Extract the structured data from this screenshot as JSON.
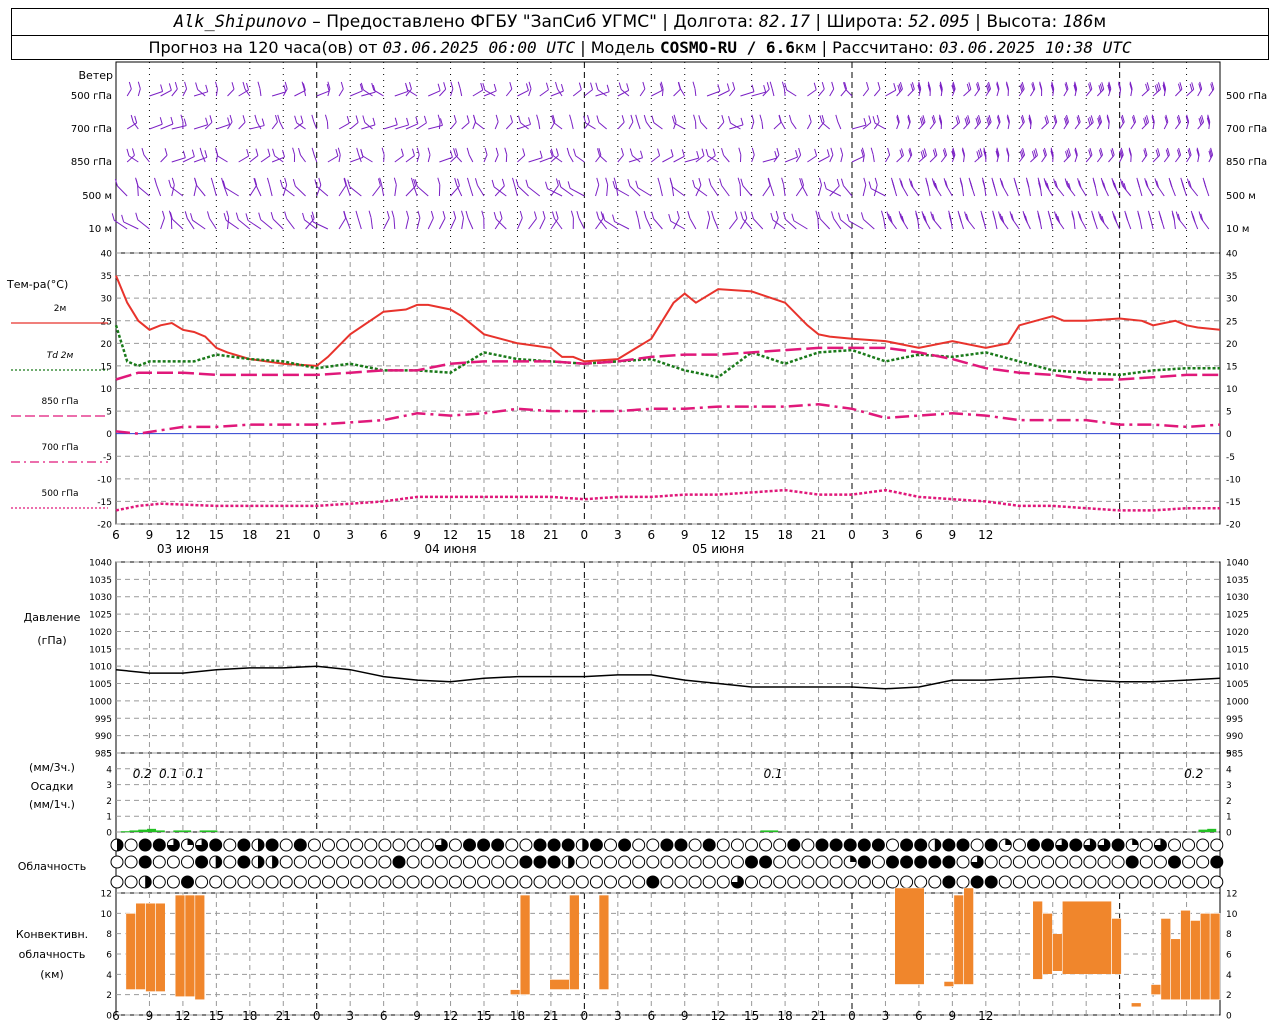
{
  "header": {
    "station": "Alk_Shipunovo",
    "provider": " – Предоставлено ФГБУ \"ЗапСиб УГМС\" | Долгота: ",
    "lon": "82.17",
    "lat_label": " | Широта: ",
    "lat": "52.095",
    "alt_label": " | Высота: ",
    "alt": "186",
    "alt_unit": "м",
    "fc_label": "Прогноз на 120 часа(ов) от ",
    "fc_time": "03.06.2025 06:00 UTC",
    "model_label": "  | Модель ",
    "model": "COSMO-RU / 6.6",
    "model_unit": "км",
    "calc_label": " | Рассчитано: ",
    "calc_time": "03.06.2025 10:38 UTC"
  },
  "panels": {
    "wind": {
      "title": "Ветер",
      "levels": [
        "500 гПа",
        "700 гПа",
        "850 гПа",
        "500 м",
        "10  м"
      ]
    },
    "temperature": {
      "title": "Тем-ра(°С)",
      "legend": [
        {
          "label": "2м",
          "color": "#e8332c",
          "style": "solid"
        },
        {
          "label": "Td  2м",
          "color": "#1a7a1a",
          "style": "dot"
        },
        {
          "label": "850 гПа",
          "color": "#e0187a",
          "style": "longdash"
        },
        {
          "label": "700 гПа",
          "color": "#e0187a",
          "style": "dashdot"
        },
        {
          "label": "500 гПа",
          "color": "#e0187a",
          "style": "dot"
        }
      ],
      "yticks": [
        40,
        35,
        30,
        25,
        20,
        15,
        10,
        5,
        0,
        -5,
        -10,
        -15,
        -20
      ]
    },
    "pressure": {
      "title": "Давление",
      "unit": "(гПа)",
      "yticks": [
        1040,
        1035,
        1030,
        1025,
        1020,
        1015,
        1010,
        1005,
        1000,
        995,
        990,
        985
      ]
    },
    "precip": {
      "label1": "(мм/3ч.)",
      "label2": "Осадки",
      "label3": "(мм/1ч.)",
      "yticks": [
        5,
        4,
        3,
        2,
        1,
        0
      ],
      "annotations": [
        {
          "x": 9,
          "text": "0.2"
        },
        {
          "x": 12,
          "text": "0.1"
        },
        {
          "x": 15,
          "text": "0.1"
        },
        {
          "x": 81,
          "text": "0.1"
        },
        {
          "x": 129,
          "text": "0.2"
        }
      ]
    },
    "cloud": {
      "title": "Облачность"
    },
    "convective": {
      "title1": "Конвективн.",
      "title2": "облачность",
      "title3": "(км)",
      "yticks": [
        12,
        10,
        8,
        6,
        4,
        2,
        0
      ]
    }
  },
  "xaxis": {
    "hour_labels": [
      "6",
      "9",
      "12",
      "15",
      "18",
      "21",
      "0",
      "3",
      "6",
      "9",
      "12",
      "15",
      "18",
      "21",
      "0",
      "3",
      "6",
      "9",
      "12",
      "15",
      "18",
      "21",
      "0",
      "3",
      "6",
      "9",
      "12"
    ],
    "day_labels": [
      {
        "x": 12,
        "text": "03 июня"
      },
      {
        "x": 36,
        "text": "04 июня"
      },
      {
        "x": 60,
        "text": "05 июня"
      }
    ]
  },
  "chart_data": [
    {
      "type": "line",
      "title": "Тем-ра(°С)",
      "x_unit": "hours since 03.06.2025 00 UTC",
      "ylim": [
        -20,
        40
      ],
      "series": [
        {
          "name": "2м",
          "x": [
            6,
            7,
            8,
            9,
            10,
            11,
            12,
            13,
            14,
            15,
            16,
            18,
            21,
            24,
            25,
            27,
            30,
            32,
            33,
            34,
            36,
            37,
            39,
            42,
            45,
            46,
            47,
            48,
            51,
            54,
            55,
            56,
            57,
            58,
            60,
            63,
            66,
            68,
            69,
            70,
            72,
            75,
            78,
            81,
            84,
            86,
            87,
            90,
            91,
            93,
            96,
            98,
            99,
            101,
            102,
            103,
            105
          ],
          "y": [
            35,
            29,
            25,
            23,
            24,
            24.5,
            23,
            22.5,
            21.5,
            19,
            18,
            16.5,
            15.5,
            15,
            17,
            22,
            27,
            27.5,
            28.5,
            28.5,
            27.5,
            26,
            22,
            20,
            19,
            17,
            17,
            16,
            16.5,
            21,
            25,
            29,
            31,
            29,
            32,
            31.5,
            29,
            24,
            22,
            21.5,
            21,
            20.5,
            19,
            20.5,
            19,
            20,
            24,
            26,
            25,
            25,
            25.5,
            25,
            24,
            25,
            24,
            23.5,
            23
          ]
        },
        {
          "name": "Td  2м",
          "x": [
            6,
            7,
            8,
            9,
            11,
            13,
            15,
            18,
            21,
            24,
            27,
            30,
            33,
            36,
            39,
            42,
            45,
            48,
            51,
            54,
            57,
            60,
            63,
            66,
            69,
            72,
            75,
            78,
            81,
            84,
            87,
            90,
            93,
            96,
            99,
            102,
            105
          ],
          "y": [
            24,
            16,
            15,
            16,
            16,
            16,
            17.5,
            16.5,
            16,
            14.5,
            15.5,
            14,
            14,
            13.5,
            18,
            16.5,
            16,
            15.5,
            16,
            16.5,
            14,
            12.5,
            18,
            15.5,
            18,
            18.5,
            16,
            17.5,
            17,
            18,
            16,
            14,
            13.5,
            13,
            14,
            14.5,
            14.5
          ]
        },
        {
          "name": "850 гПа",
          "x": [
            6,
            8,
            12,
            15,
            18,
            21,
            24,
            27,
            30,
            33,
            36,
            39,
            42,
            45,
            48,
            51,
            54,
            57,
            60,
            63,
            66,
            69,
            72,
            75,
            78,
            81,
            84,
            87,
            90,
            93,
            96,
            99,
            102,
            105
          ],
          "y": [
            12,
            13.5,
            13.5,
            13,
            13,
            13,
            13,
            13.5,
            14,
            14,
            15.5,
            16,
            16,
            16,
            15.5,
            16,
            17,
            17.5,
            17.5,
            18,
            18.5,
            19,
            19,
            19,
            18,
            16.5,
            14.5,
            13.5,
            13,
            12,
            12,
            12.5,
            13,
            13
          ]
        },
        {
          "name": "700 гПа",
          "x": [
            6,
            8,
            12,
            15,
            18,
            21,
            24,
            27,
            30,
            33,
            36,
            39,
            42,
            45,
            48,
            51,
            54,
            57,
            60,
            63,
            66,
            69,
            72,
            75,
            78,
            81,
            84,
            87,
            90,
            93,
            96,
            99,
            102,
            105
          ],
          "y": [
            0.5,
            0,
            1.5,
            1.5,
            2,
            2,
            2,
            2.5,
            3,
            4.5,
            4,
            4.5,
            5.5,
            5,
            5,
            5,
            5.5,
            5.5,
            6,
            6,
            6,
            6.5,
            5.5,
            3.5,
            4,
            4.5,
            4,
            3,
            3,
            3,
            2,
            2,
            1.5,
            2
          ]
        },
        {
          "name": "500 гПа",
          "x": [
            6,
            8,
            10,
            15,
            18,
            21,
            24,
            27,
            30,
            33,
            36,
            39,
            42,
            45,
            48,
            51,
            54,
            57,
            60,
            63,
            66,
            69,
            72,
            75,
            78,
            81,
            84,
            87,
            90,
            93,
            96,
            99,
            102,
            105
          ],
          "y": [
            -17,
            -16,
            -15.5,
            -16,
            -16,
            -16,
            -16,
            -15.5,
            -15,
            -14,
            -14,
            -14,
            -14,
            -14,
            -14.5,
            -14,
            -14,
            -13.5,
            -13.5,
            -13,
            -12.5,
            -13.5,
            -13.5,
            -12.5,
            -14,
            -14.5,
            -15,
            -16,
            -16,
            -16.5,
            -17,
            -17,
            -16.5,
            -16.5
          ]
        }
      ]
    },
    {
      "type": "line",
      "title": "Давление",
      "ylim": [
        985,
        1040
      ],
      "series": [
        {
          "name": "",
          "x": [
            6,
            9,
            12,
            15,
            18,
            21,
            24,
            27,
            30,
            33,
            36,
            39,
            42,
            45,
            48,
            51,
            54,
            57,
            60,
            63,
            66,
            69,
            72,
            75,
            78,
            81,
            84,
            87,
            90,
            93,
            96,
            99,
            102,
            105
          ],
          "y": [
            1009,
            1008,
            1008,
            1009,
            1009.5,
            1009.5,
            1010,
            1009,
            1007,
            1006,
            1005.5,
            1006.5,
            1007,
            1007,
            1007,
            1007.5,
            1007.5,
            1006,
            1005,
            1004,
            1004,
            1004,
            1004,
            1003.5,
            1004,
            1006,
            1006,
            1006.5,
            1007,
            1006,
            1005.5,
            1005.5,
            1006,
            1006.5
          ]
        }
      ]
    },
    {
      "type": "bar",
      "title": "Осадки",
      "ylim": [
        0,
        5
      ],
      "x": [
        7,
        8,
        9,
        10,
        11,
        13,
        14,
        16,
        17,
        80,
        81,
        130,
        131
      ],
      "values": [
        0.05,
        0.1,
        0.15,
        0.2,
        0.1,
        0.1,
        0.1,
        0.1,
        0.1,
        0.1,
        0.1,
        0.15,
        0.2
      ]
    },
    {
      "type": "bar",
      "title": "Конвективн. облачность",
      "ylim": [
        0,
        12
      ],
      "bars": [
        {
          "x0": 7,
          "x1": 8,
          "bottom": 2.5,
          "top": 10
        },
        {
          "x0": 8,
          "x1": 9,
          "bottom": 2.5,
          "top": 11
        },
        {
          "x0": 9,
          "x1": 10,
          "bottom": 2.3,
          "top": 11
        },
        {
          "x0": 10,
          "x1": 11,
          "bottom": 2.3,
          "top": 11
        },
        {
          "x0": 12,
          "x1": 13,
          "bottom": 1.8,
          "top": 11.8
        },
        {
          "x0": 13,
          "x1": 14,
          "bottom": 1.8,
          "top": 11.8
        },
        {
          "x0": 14,
          "x1": 15,
          "bottom": 1.5,
          "top": 11.8
        },
        {
          "x0": 46,
          "x1": 47,
          "bottom": 2,
          "top": 2.5
        },
        {
          "x0": 47,
          "x1": 48,
          "bottom": 2,
          "top": 11.8
        },
        {
          "x0": 50,
          "x1": 52,
          "bottom": 2.5,
          "top": 3.5
        },
        {
          "x0": 52,
          "x1": 53,
          "bottom": 2.5,
          "top": 11.8
        },
        {
          "x0": 55,
          "x1": 56,
          "bottom": 2.5,
          "top": 11.8
        },
        {
          "x0": 85,
          "x1": 88,
          "bottom": 3,
          "top": 12.5
        },
        {
          "x0": 90,
          "x1": 91,
          "bottom": 2.8,
          "top": 3.3
        },
        {
          "x0": 91,
          "x1": 92,
          "bottom": 3,
          "top": 11.8
        },
        {
          "x0": 92,
          "x1": 93,
          "bottom": 3,
          "top": 12.5
        },
        {
          "x0": 99,
          "x1": 100,
          "bottom": 3.5,
          "top": 11.2
        },
        {
          "x0": 100,
          "x1": 101,
          "bottom": 4,
          "top": 10
        },
        {
          "x0": 101,
          "x1": 102,
          "bottom": 4.3,
          "top": 8
        },
        {
          "x0": 102,
          "x1": 107,
          "bottom": 4,
          "top": 11.2
        },
        {
          "x0": 107,
          "x1": 108,
          "bottom": 4,
          "top": 9.5
        },
        {
          "x0": 109,
          "x1": 110,
          "bottom": 0.8,
          "top": 1.2
        },
        {
          "x0": 111,
          "x1": 112,
          "bottom": 2,
          "top": 3
        },
        {
          "x0": 112,
          "x1": 113,
          "bottom": 1.5,
          "top": 9.5
        },
        {
          "x0": 113,
          "x1": 114,
          "bottom": 1.5,
          "top": 7.5
        },
        {
          "x0": 114,
          "x1": 115,
          "bottom": 1.5,
          "top": 10.3
        },
        {
          "x0": 115,
          "x1": 116,
          "bottom": 1.5,
          "top": 9.3
        },
        {
          "x0": 116,
          "x1": 117,
          "bottom": 1.5,
          "top": 10
        },
        {
          "x0": 117,
          "x1": 118,
          "bottom": 1.5,
          "top": 10
        }
      ]
    }
  ]
}
